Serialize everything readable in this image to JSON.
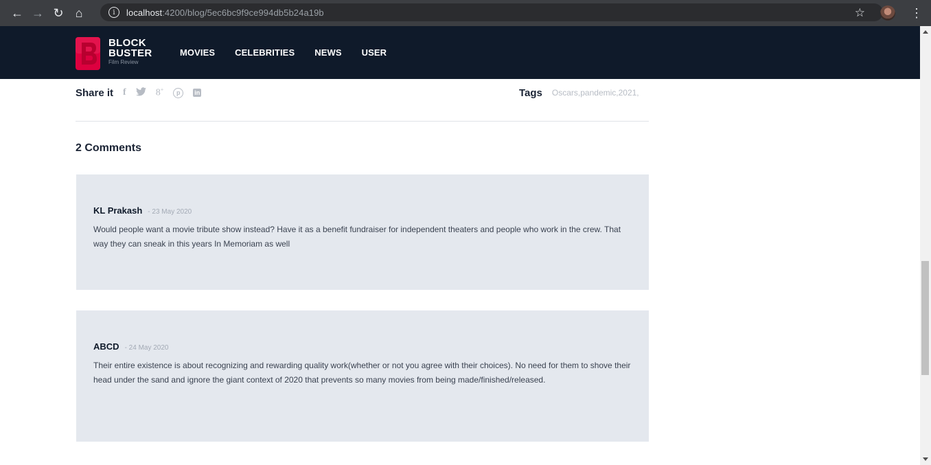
{
  "browser": {
    "url_host": "localhost",
    "url_rest": ":4200/blog/5ec6bc9f9ce994db5b24a19b"
  },
  "header": {
    "logo": {
      "letter": "B",
      "line1": "BLOCK",
      "line2": "BUSTER",
      "tagline": "Film Review"
    },
    "menu": [
      "MOVIES",
      "CELEBRITIES",
      "NEWS",
      "USER"
    ],
    "bg_color": "#0f1a2a",
    "brand_color": "#dd003f"
  },
  "share": {
    "label": "Share it",
    "icons": [
      "facebook-icon",
      "twitter-icon",
      "google-plus-icon",
      "pinterest-icon",
      "linkedin-icon"
    ]
  },
  "tags": {
    "label": "Tags",
    "value": "Oscars,pandemic,2021,"
  },
  "comments": {
    "title": "2 Comments",
    "items": [
      {
        "author": "KL Prakash",
        "date": "- 23 May 2020",
        "body": "Would people want a movie tribute show instead? Have it as a benefit fundraiser for independent theaters and people who work in the crew. That way they can sneak in this years In Memoriam as well"
      },
      {
        "author": "ABCD",
        "date": "- 24 May 2020",
        "body": "Their entire existence is about recognizing and rewarding quality work(whether or not you agree with their choices). No need for them to shove their head under the sand and ignore the giant context of 2020 that prevents so many movies from being made/finished/released."
      }
    ]
  }
}
